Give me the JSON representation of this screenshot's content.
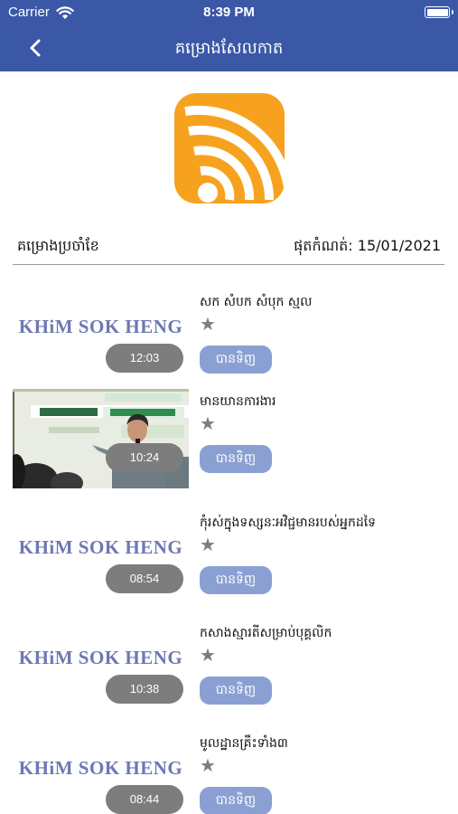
{
  "status_bar": {
    "carrier": "Carrier",
    "time": "8:39 PM"
  },
  "nav": {
    "title": "គម្រោងសែលកាត",
    "back_icon": "chevron-left-icon"
  },
  "app_logo_icon": "broadcast-waves-icon",
  "section": {
    "label": "គម្រោងប្រចាំខែ",
    "updated": "ផុតកំណត់: 15/01/2021"
  },
  "episodes": [
    {
      "title": "សក សំបក សំបុក ស្មល",
      "brand": "KHiM SOK HENG",
      "duration": "12:03",
      "listen_label": "បានទិញ",
      "star": "★"
    },
    {
      "title": "មានយានការងារ",
      "brand": "",
      "duration": "10:24",
      "listen_label": "បានទិញ",
      "star": "★"
    },
    {
      "title": "កុំរស់ក្នុងទស្សនៈអវិជ្ជមានរបស់អ្នកដទៃ",
      "brand": "KHiM SOK HENG",
      "duration": "08:54",
      "listen_label": "បានទិញ",
      "star": "★"
    },
    {
      "title": "កសាងស្មារតីសម្រាប់បុគ្គលិក",
      "brand": "KHiM SOK HENG",
      "duration": "10:38",
      "listen_label": "បានទិញ",
      "star": "★"
    },
    {
      "title": "មូលដ្ឋានគ្រឹះទាំង៣",
      "brand": "KHiM SOK HENG",
      "duration": "08:44",
      "listen_label": "បានទិញ",
      "star": "★"
    }
  ],
  "colors": {
    "nav_bg": "#3a58a6",
    "logo_bg": "#f7a21f",
    "duration_pill": "#7d7d7d",
    "listen_button": "#8aa0d2",
    "brand_text": "#6d78b3"
  }
}
